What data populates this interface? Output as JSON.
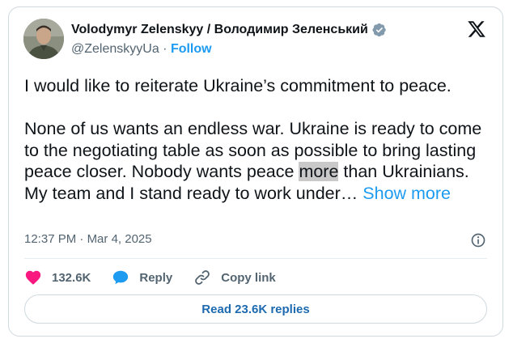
{
  "author": {
    "display_name": "Volodymyr Zelenskyy / Володимир Зеленський",
    "handle": "@ZelenskyyUa",
    "separator": " · ",
    "follow_label": "Follow"
  },
  "tweet": {
    "paragraph_1": "I would like to reiterate Ukraine’s commitment to peace.",
    "paragraph_2_before": "None of us wants an endless war. Ukraine is ready to come to the negotiating table as soon as possible to bring lasting peace closer. Nobody wants peace ",
    "paragraph_2_highlight": "more",
    "paragraph_2_after": " than Ukrainians. My team and I stand ready to work under… ",
    "show_more_label": "Show more"
  },
  "meta": {
    "time": "12:37 PM",
    "separator": " · ",
    "date": "Mar 4, 2025"
  },
  "actions": {
    "likes_count": "132.6K",
    "reply_label": "Reply",
    "copy_link_label": "Copy link"
  },
  "read_replies_label": "Read 23.6K replies",
  "icons": {
    "verified": "verified-badge-icon",
    "x_logo": "x-logo-icon",
    "info": "info-icon",
    "like": "heart-icon",
    "reply": "reply-bubble-icon",
    "copy_link": "link-icon"
  },
  "colors": {
    "accent": "#1d9bf0",
    "like": "#f91880",
    "verified_badge": "#829aab",
    "muted_text": "#536471"
  }
}
